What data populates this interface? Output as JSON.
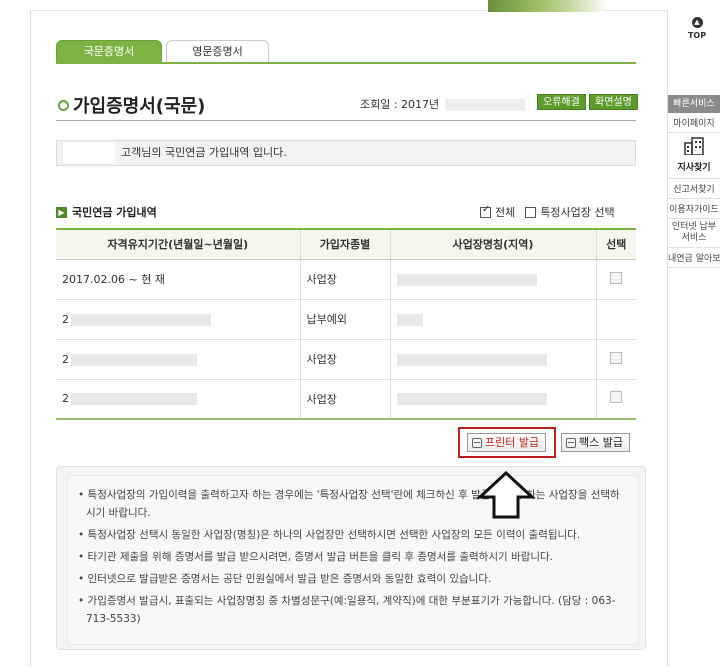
{
  "tabs": [
    {
      "label": "국문증명서"
    },
    {
      "label": "영문증명서"
    }
  ],
  "page_title": "가입증명서(국문)",
  "inquiry_date_label": "조회일 : 2017년",
  "header_buttons": {
    "error_fix": "오류해결",
    "screen_help": "화면설명"
  },
  "info_message": "고객님의 국민연금 가입내역 입니다.",
  "section_title": "국민연금 가입내역",
  "filters": {
    "all": "전체",
    "specific": "특정사업장 선택",
    "all_checked": true,
    "specific_checked": false
  },
  "table": {
    "headers": [
      "자격유지기간(년월일~년월일)",
      "가입자종별",
      "사업장명칭(지역)",
      "선택"
    ],
    "rows": [
      {
        "period": "2017.02.06 ~ 현 재",
        "type": "사업장"
      },
      {
        "period": "2",
        "type": "납부예외"
      },
      {
        "period": "2",
        "type": "사업장"
      },
      {
        "period": "2",
        "type": "사업장"
      }
    ]
  },
  "buttons": {
    "print": "프린터 발급",
    "fax": "팩스 발급"
  },
  "notes": [
    "특정사업장의 가입이력을 출력하고자 하는 경우에는 '특정사업장 선택'란에 체크하신 후 발급 받고자 하는 사업장을 선택하시기 바랍니다.",
    "특정사업장 선택시 동일한 사업장(명칭)은 하나의 사업장만 선택하시면 선택한 사업장의 모든 이력이 출력됩니다.",
    "타기관 제출을 위해 증명서를 발급 받으시려면, 증명서 발급 버튼을 클릭 후 증명서를 출력하시기 바랍니다.",
    "인터넷으로 발급받은 증명서는 공단 민원실에서 발급 받은 증명서와 동일한 효력이 있습니다.",
    "가입증명서 발급시, 표출되는 사업장명칭 중 차별성문구(예:일용직, 계약직)에 대한 부분표기가 가능합니다. (담당 : 063-713-5533)"
  ],
  "side": {
    "top": "TOP",
    "quick_title": "빠른서비스",
    "items": [
      "마이페이지",
      "지사찾기",
      "신고서찾기",
      "이용자가이드",
      "인터넷 납부서비스",
      "내연금 알아보기"
    ]
  },
  "colors": {
    "brand_green": "#7fb245",
    "highlight_red": "#c21d1d"
  }
}
